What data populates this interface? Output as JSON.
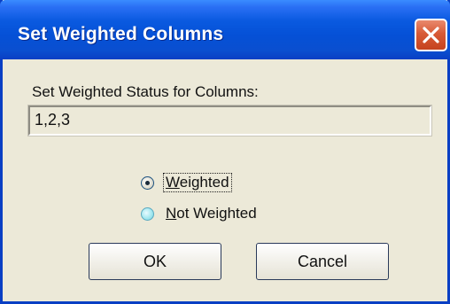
{
  "window": {
    "title": "Set Weighted Columns",
    "close_icon": "close-icon"
  },
  "dialog": {
    "prompt": "Set Weighted Status for Columns:",
    "columns_value": "1,2,3",
    "options": [
      {
        "label": "Weighted",
        "selected": true
      },
      {
        "label": "Not Weighted",
        "selected": false
      }
    ],
    "ok_label": "OK",
    "cancel_label": "Cancel"
  },
  "colors": {
    "titlebar": "#0a4fd0",
    "close_button": "#d85a36",
    "dialog_background": "#ece9d8"
  }
}
